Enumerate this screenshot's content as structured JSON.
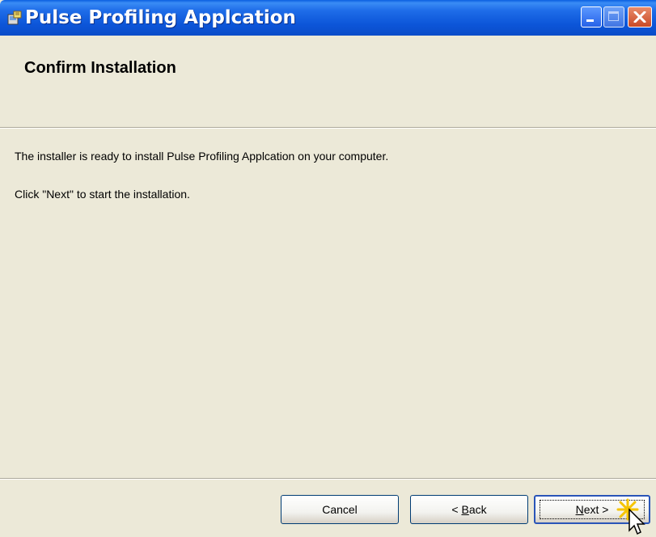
{
  "window": {
    "title": "Pulse Profiling Applcation",
    "icon": "installer-icon"
  },
  "header": {
    "title": "Confirm Installation"
  },
  "content": {
    "line1": "The installer is ready to install Pulse Profiling Applcation on your computer.",
    "line2": "Click \"Next\" to start the installation."
  },
  "buttons": {
    "cancel": "Cancel",
    "back_prefix": "< ",
    "back_accel": "B",
    "back_rest": "ack",
    "next_accel": "N",
    "next_rest": "ext >"
  },
  "colors": {
    "titlebar": "#0A5FE0",
    "window_bg": "#ECE9D8",
    "close_button": "#C94A26"
  }
}
